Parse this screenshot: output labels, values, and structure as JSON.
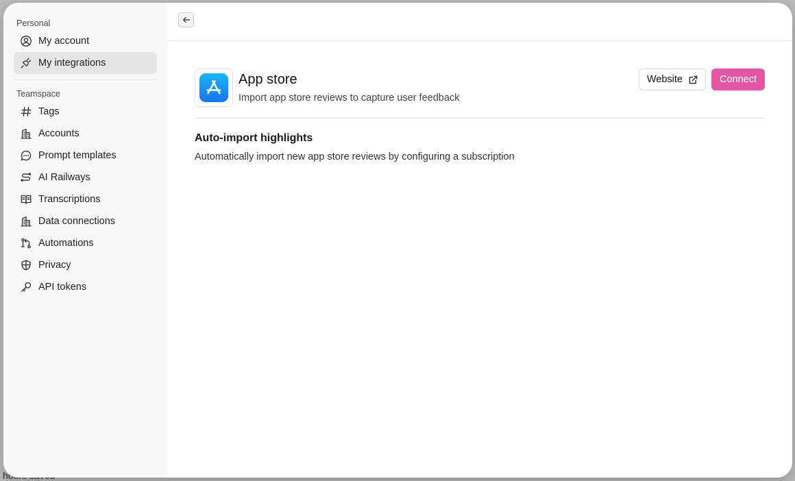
{
  "background": {
    "bottom_text": "hours saved"
  },
  "sidebar": {
    "personal_label": "Personal",
    "personal_items": [
      {
        "label": "My account",
        "icon": "user-circle-icon"
      },
      {
        "label": "My integrations",
        "icon": "plug-icon",
        "active": true
      }
    ],
    "teamspace_label": "Teamspace",
    "teamspace_items": [
      {
        "label": "Tags",
        "icon": "hash-icon"
      },
      {
        "label": "Accounts",
        "icon": "building-icon"
      },
      {
        "label": "Prompt templates",
        "icon": "chat-bubble-icon"
      },
      {
        "label": "AI Railways",
        "icon": "route-icon"
      },
      {
        "label": "Transcriptions",
        "icon": "book-open-icon"
      },
      {
        "label": "Data connections",
        "icon": "building-icon"
      },
      {
        "label": "Automations",
        "icon": "git-branch-icon"
      },
      {
        "label": "Privacy",
        "icon": "shield-icon"
      },
      {
        "label": "API tokens",
        "icon": "key-icon"
      }
    ]
  },
  "integration": {
    "title": "App store",
    "subtitle": "Import app store reviews to capture user feedback",
    "website_label": "Website",
    "connect_label": "Connect",
    "section_title": "Auto-import highlights",
    "section_desc": "Automatically import new app store reviews by configuring a subscription"
  },
  "colors": {
    "accent": "#e256a4",
    "app_icon_top": "#1cb4f7",
    "app_icon_bottom": "#1575f0",
    "sidebar_bg": "#f8f8f8",
    "active_item_bg": "#e6e6e6"
  }
}
